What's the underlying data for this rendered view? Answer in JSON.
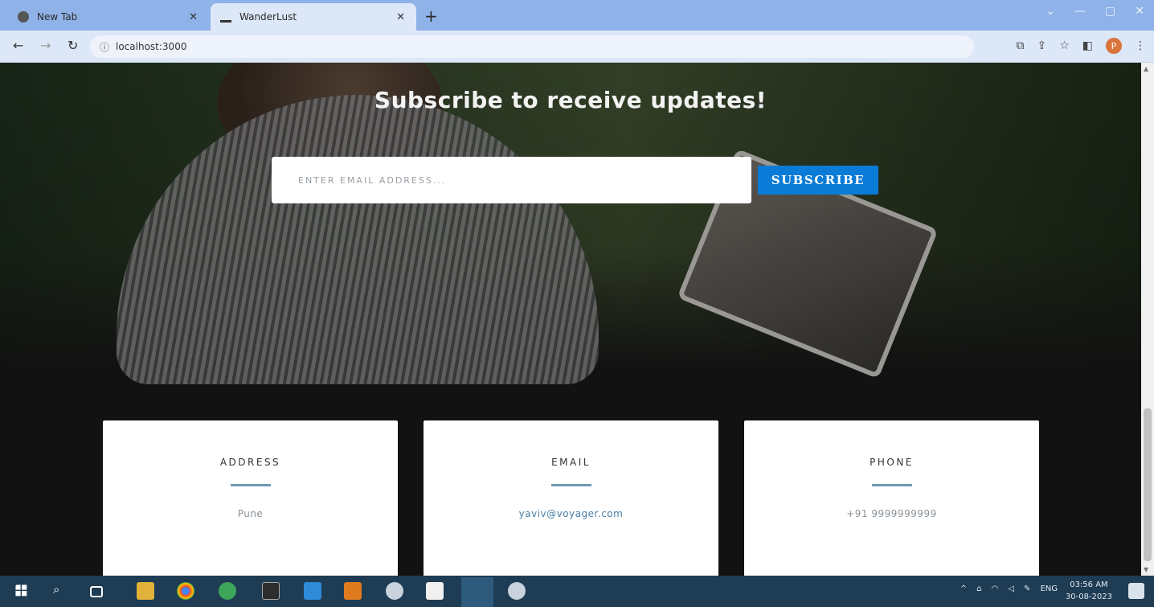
{
  "browser": {
    "tabs": [
      {
        "title": "New Tab",
        "active": false
      },
      {
        "title": "WanderLust",
        "active": true
      }
    ],
    "url": "localhost:3000"
  },
  "hero": {
    "headline": "Subscribe to receive updates!",
    "email_placeholder": "ENTER EMAIL ADDRESS...",
    "subscribe_label": "SUBSCRIBE"
  },
  "contact_cards": [
    {
      "title": "ADDRESS",
      "value": "Pune"
    },
    {
      "title": "EMAIL",
      "value": "yaviv@voyager.com"
    },
    {
      "title": "PHONE",
      "value": "+91 9999999999"
    }
  ],
  "taskbar": {
    "language": "ENG",
    "time": "03:56 AM",
    "date": "30-08-2023"
  },
  "colors": {
    "accent": "#0a7bd6",
    "divider": "#6f9ab1",
    "chrome": "#dce7f8",
    "taskbar": "#1e3c54"
  }
}
